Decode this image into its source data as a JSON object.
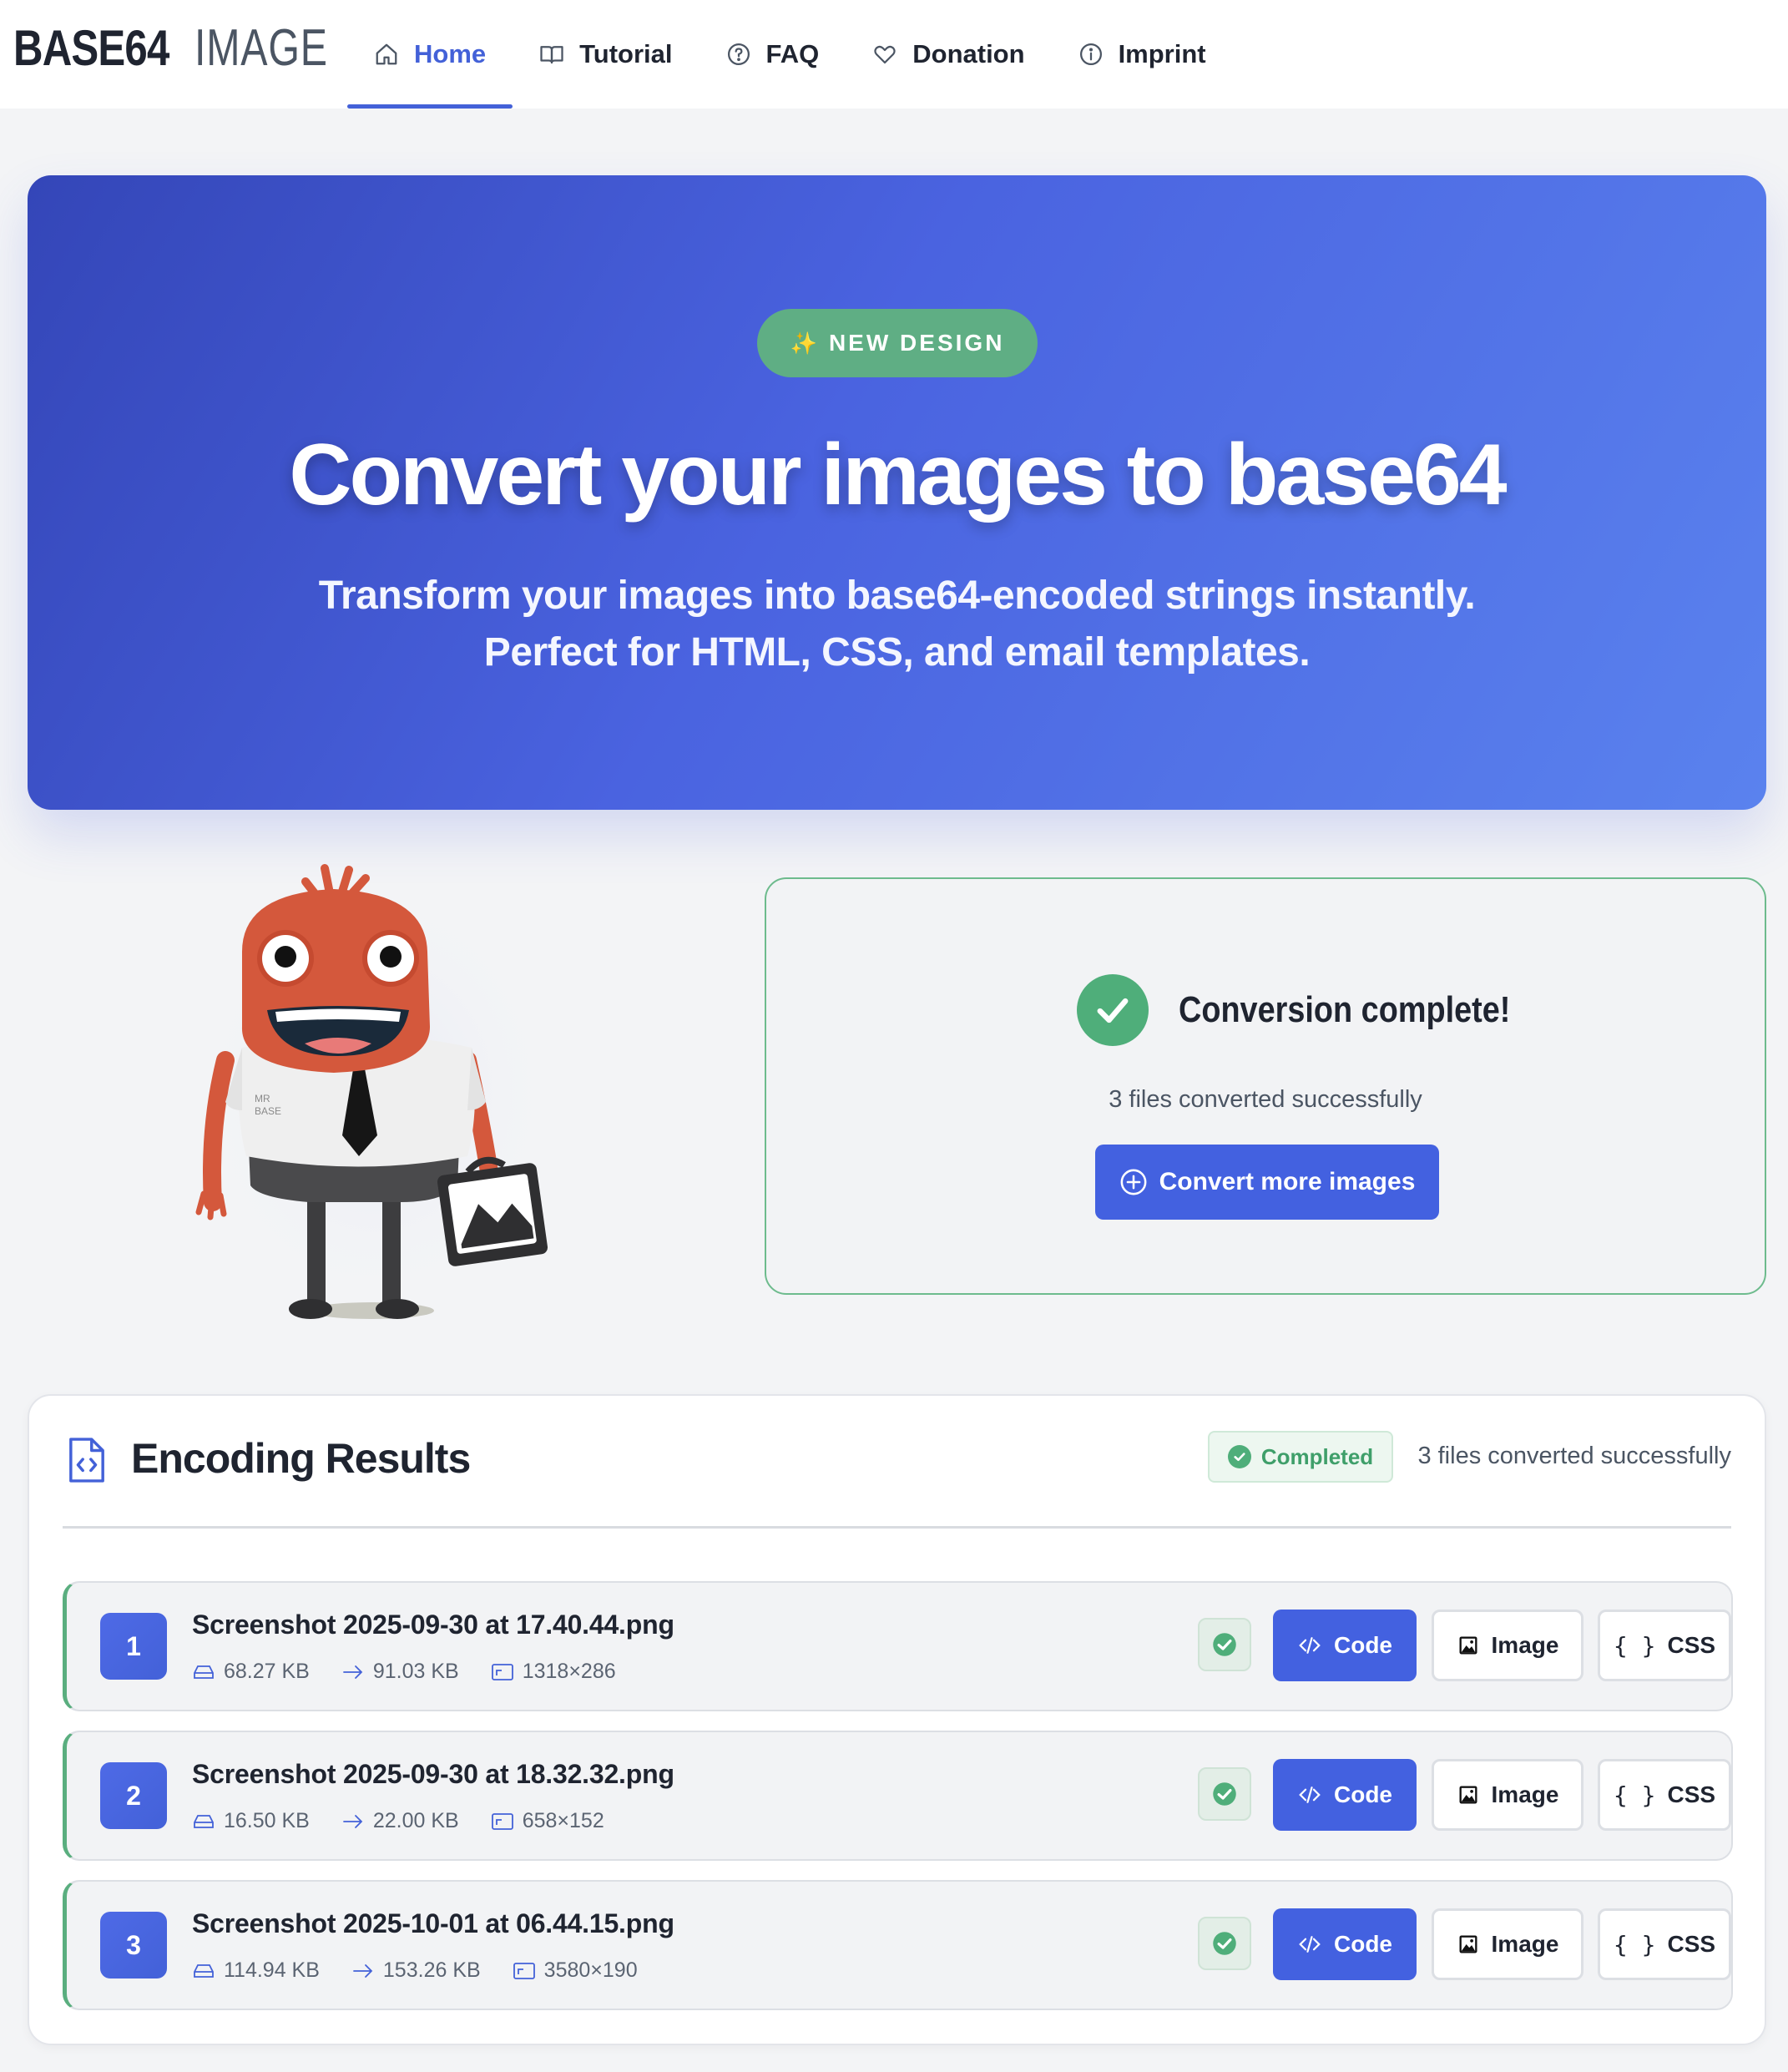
{
  "brand": {
    "part1": "BASE64",
    "part2": "IMAGE"
  },
  "nav": {
    "items": [
      {
        "label": "Home",
        "icon": "home-icon",
        "active": true
      },
      {
        "label": "Tutorial",
        "icon": "book-icon",
        "active": false
      },
      {
        "label": "FAQ",
        "icon": "question-icon",
        "active": false
      },
      {
        "label": "Donation",
        "icon": "heart-icon",
        "active": false
      },
      {
        "label": "Imprint",
        "icon": "info-icon",
        "active": false
      }
    ]
  },
  "hero": {
    "badge": "NEW DESIGN",
    "badge_icon": "sparkle-icon",
    "title": "Convert your images to base64",
    "subtitle_line1": "Transform your images into base64-encoded strings instantly.",
    "subtitle_line2": "Perfect for HTML, CSS, and email templates."
  },
  "mascot": {
    "shirt_text": "MR BASE"
  },
  "conversion": {
    "title": "Conversion complete!",
    "subtitle": "3 files converted successfully",
    "button_label": "Convert more images"
  },
  "results": {
    "title": "Encoding Results",
    "status_badge": "Completed",
    "summary": "3 files converted successfully",
    "files": [
      {
        "number": "1",
        "name": "Screenshot 2025-09-30 at 17.40.44.png",
        "original_size": "68.27 KB",
        "encoded_size": "91.03 KB",
        "dimensions": "1318×286"
      },
      {
        "number": "2",
        "name": "Screenshot 2025-09-30 at 18.32.32.png",
        "original_size": "16.50 KB",
        "encoded_size": "22.00 KB",
        "dimensions": "658×152"
      },
      {
        "number": "3",
        "name": "Screenshot 2025-10-01 at 06.44.15.png",
        "original_size": "114.94 KB",
        "encoded_size": "153.26 KB",
        "dimensions": "3580×190"
      }
    ],
    "buttons": {
      "code": "Code",
      "image": "Image",
      "css": "CSS"
    }
  },
  "colors": {
    "primary": "#4361e0",
    "success": "#4fae7a",
    "hero_start": "#3446b8",
    "hero_end": "#5a82ee"
  }
}
